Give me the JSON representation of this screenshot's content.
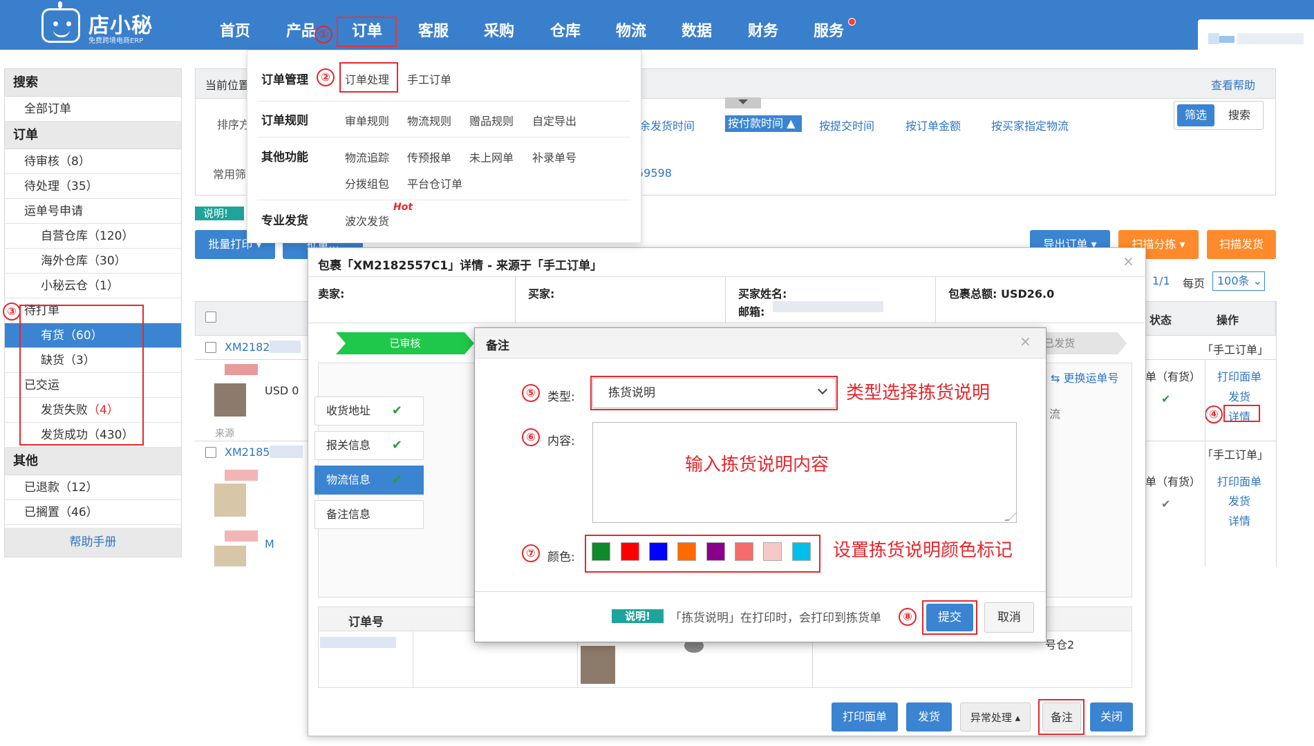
{
  "app": {
    "logo_title": "店小秘",
    "logo_sub": "免费跨境电商ERP"
  },
  "nav": {
    "items": [
      "首页",
      "产品",
      "订单",
      "客服",
      "采购",
      "仓库",
      "物流",
      "数据",
      "财务",
      "服务"
    ],
    "active": "订单"
  },
  "annotations": {
    "n1": "①",
    "n2": "②",
    "n3": "③",
    "n4": "④",
    "n5": "⑤",
    "n6": "⑥",
    "n7": "⑦",
    "n8": "⑧",
    "type_hint": "类型选择拣货说明",
    "content_hint": "输入拣货说明内容",
    "color_hint": "设置拣货说明颜色标记"
  },
  "sidebar": {
    "search_head": "搜索",
    "all_orders": "全部订单",
    "order_head": "订单",
    "items": [
      {
        "label": "待审核",
        "count": "（8）"
      },
      {
        "label": "待处理",
        "count": "（35）"
      },
      {
        "label": "运单号申请",
        "count": ""
      },
      {
        "label": "自营仓库",
        "count": "（120）"
      },
      {
        "label": "海外仓库",
        "count": "（30）"
      },
      {
        "label": "小秘云仓",
        "count": "（1）"
      },
      {
        "label": "待打单",
        "count": ""
      },
      {
        "label": "有货",
        "count": "（60）"
      },
      {
        "label": "缺货",
        "count": "（3）"
      },
      {
        "label": "已交运",
        "count": ""
      },
      {
        "label": "发货失败",
        "count": "（4）"
      },
      {
        "label": "发货成功",
        "count": "（430）"
      }
    ],
    "other_head": "其他",
    "other_items": [
      {
        "label": "已退款",
        "count": "（12）"
      },
      {
        "label": "已搁置",
        "count": "（46）"
      }
    ],
    "help": "帮助手册"
  },
  "main": {
    "crumb": "当前位置",
    "help_link": "查看帮助",
    "sort_label": "排序方",
    "sort_links": [
      "余发货时间",
      "按付款时间",
      "按提交时间",
      "按订单金额",
      "按买家指定物流"
    ],
    "filter_btn": "筛选",
    "search_btn": "搜索",
    "common_filter": "常用筛",
    "order_partial": "59598",
    "desc_badge": "说明!",
    "batch_print": "批量打印",
    "batch_other": "批量...",
    "export": "导出订单",
    "scan_sort": "扫描分拣",
    "scan_ship": "扫描发货",
    "pager": "1/1",
    "per_page_label": "每页",
    "per_page_value": "100条",
    "col_state": "状态",
    "col_action": "操作",
    "rows": [
      {
        "order": "XM2182",
        "source": "「手工订单」",
        "stock": "单（有货）",
        "actions": [
          "打印面单",
          "发货",
          "详情"
        ],
        "amount": "USD 0",
        "origin": "来源"
      },
      {
        "order": "XM2185",
        "source": "「手工订单」",
        "stock": "单（有货）",
        "actions": [
          "打印面单",
          "发货",
          "详情"
        ],
        "extra": "M"
      }
    ]
  },
  "dropdown": {
    "groups": [
      {
        "name": "订单管理",
        "items": [
          "订单处理",
          "手工订单"
        ]
      },
      {
        "name": "订单规则",
        "items": [
          "审单规则",
          "物流规则",
          "赠品规则",
          "自定导出"
        ]
      },
      {
        "name": "其他功能",
        "items": [
          "物流追踪",
          "传预报单",
          "未上网单",
          "补录单号",
          "分拨组包",
          "平台仓订单"
        ]
      },
      {
        "name": "专业发货",
        "items": [
          "波次发货"
        ]
      }
    ],
    "hot": "Hot"
  },
  "pkg_modal": {
    "title": "包裹「XM2182557C1」详情 - 来源于「手工订单」",
    "seller": "卖家:",
    "buyer": "买家:",
    "buyer_name": "买家姓名:",
    "email": "邮箱:",
    "total": "包裹总额: USD26.0",
    "step_done": "已审核",
    "step_last": "已发货",
    "tabs": [
      "收货地址",
      "报关信息",
      "物流信息",
      "备注信息"
    ],
    "change_track": "更换运单号",
    "logistics_partial": "流",
    "order_no_head": "订单号",
    "warehouse": "号仓2",
    "foot": {
      "print": "打印面单",
      "ship": "发货",
      "exception": "异常处理",
      "remark": "备注",
      "close": "关闭"
    }
  },
  "remark_modal": {
    "title": "备注",
    "type_label": "类型:",
    "type_value": "拣货说明",
    "content_label": "内容:",
    "content_value": "",
    "color_label": "颜色:",
    "colors": [
      "#0e8a2a",
      "#ff0000",
      "#0000ff",
      "#ff6a00",
      "#8b008b",
      "#f76b6b",
      "#f7c8c8",
      "#00bfe8"
    ],
    "note_badge": "说明!",
    "note_text": "「拣货说明」在打印时，会打印到拣货单",
    "submit": "提交",
    "cancel": "取消"
  }
}
